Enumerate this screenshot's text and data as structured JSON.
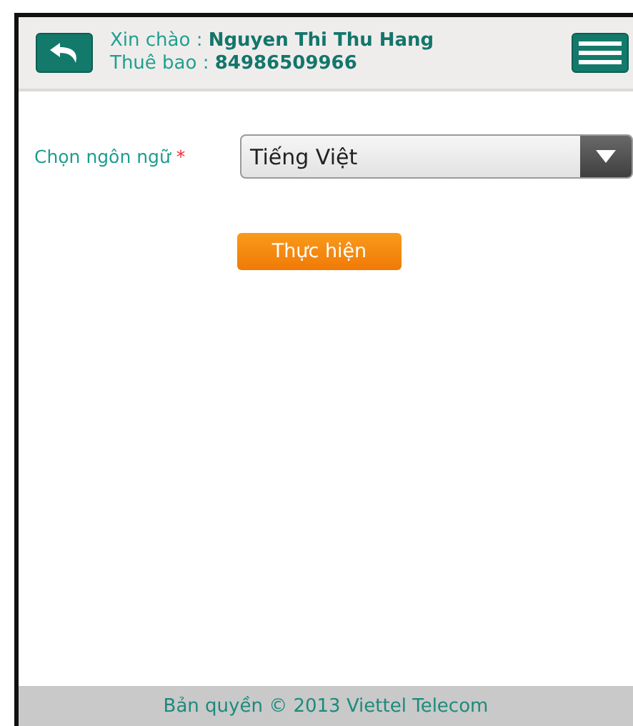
{
  "header": {
    "greeting_label": "Xin chào : ",
    "user_name": "Nguyen Thi Thu Hang",
    "subscriber_label": "Thuê bao : ",
    "subscriber_number": "84986509966"
  },
  "form": {
    "label": "Chọn ngôn ngữ",
    "required_mark": "*",
    "language": "Tiếng Việt"
  },
  "submit_button": "Thực hiện",
  "footer": "Bản quyền © 2013 Viettel Telecom"
}
